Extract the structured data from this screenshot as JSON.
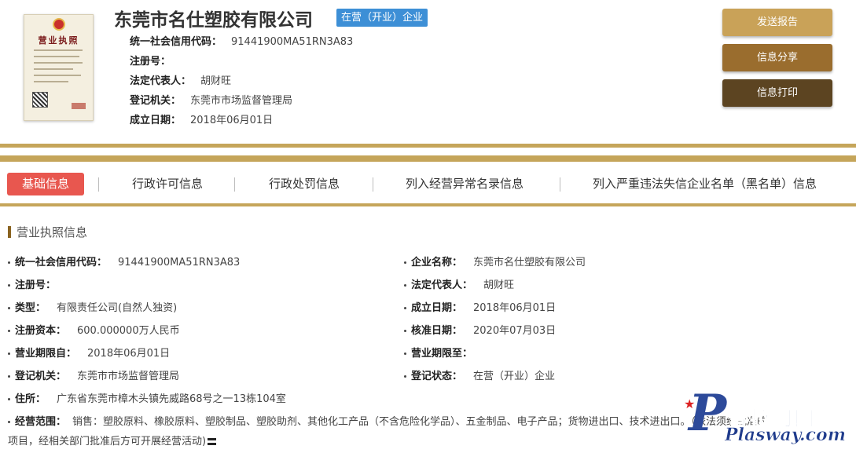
{
  "header": {
    "license_title": "营业执照",
    "company_name": "东莞市名仕塑胶有限公司",
    "status_tag": "在营（开业）企业",
    "rows": [
      {
        "label": "统一社会信用代码：",
        "value": "91441900MA51RN3A83"
      },
      {
        "label": "注册号：",
        "value": ""
      },
      {
        "label": "法定代表人：",
        "value": "胡财旺"
      },
      {
        "label": "登记机关：",
        "value": "东莞市市场监督管理局"
      },
      {
        "label": "成立日期：",
        "value": "2018年06月01日"
      }
    ],
    "buttons": {
      "send_report": "发送报告",
      "share": "信息分享",
      "print": "信息打印"
    }
  },
  "tabs": [
    {
      "label": "基础信息",
      "active": true
    },
    {
      "label": "行政许可信息"
    },
    {
      "label": "行政处罚信息"
    },
    {
      "label": "列入经营异常名录信息"
    },
    {
      "label": "列入严重违法失信企业名单（黑名单）信息"
    }
  ],
  "section": {
    "title": "营业执照信息",
    "left_fields": [
      {
        "label": "统一社会信用代码：",
        "value": "91441900MA51RN3A83"
      },
      {
        "label": "注册号：",
        "value": ""
      },
      {
        "label": "类型：",
        "value": "有限责任公司(自然人独资)"
      },
      {
        "label": "注册资本：",
        "value": "600.000000万人民币"
      },
      {
        "label": "营业期限自：",
        "value": "2018年06月01日"
      },
      {
        "label": "登记机关：",
        "value": "东莞市市场监督管理局"
      },
      {
        "label": "住所：",
        "value": "广东省东莞市樟木头镇先威路68号之一13栋104室"
      }
    ],
    "right_fields": [
      {
        "label": "企业名称：",
        "value": "东莞市名仕塑胶有限公司"
      },
      {
        "label": "法定代表人：",
        "value": "胡财旺"
      },
      {
        "label": "成立日期：",
        "value": "2018年06月01日"
      },
      {
        "label": "核准日期：",
        "value": "2020年07月03日"
      },
      {
        "label": "营业期限至：",
        "value": ""
      },
      {
        "label": "登记状态：",
        "value": "在营（开业）企业"
      }
    ],
    "scope": {
      "label": "经营范围：",
      "line1": "销售：塑胶原料、橡胶原料、塑胶制品、塑胶助剂、其他化工产品（不含危险化学品）、五金制品、电子产品；货物进出口、技术进出口。（依法须经批准的",
      "line2": "项目，经相关部门批准后方可开展经营活动)"
    }
  },
  "watermark": {
    "letter": "P",
    "cn": "普拉司网",
    "url": "Plasway.com"
  },
  "colors": {
    "gold": "#c5a55a",
    "active_tab": "#e8574f",
    "status_tag": "#3d8fd6",
    "btn_send": "#c9a258",
    "btn_share": "#9a6d2e",
    "btn_print": "#5c4421"
  }
}
